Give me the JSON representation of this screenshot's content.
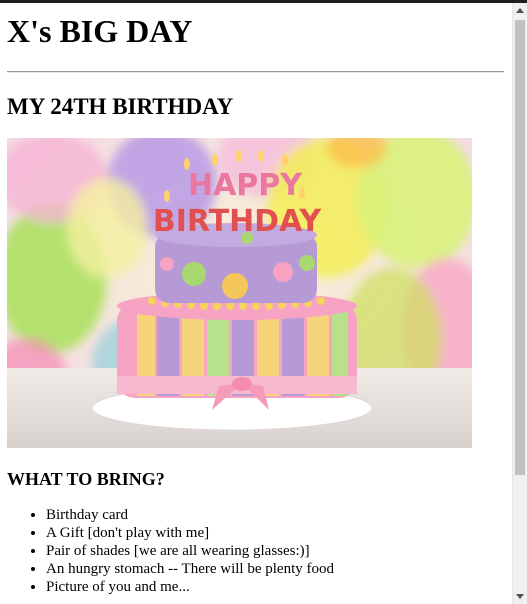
{
  "page": {
    "title": "X's BIG DAY",
    "subtitle": "MY 24TH BIRTHDAY",
    "section_heading": "WHAT TO BRING?",
    "image": {
      "cake_topper_line1": "HAPPY",
      "cake_topper_line2": "BIRTHDAY"
    },
    "bring_list": [
      "Birthday card",
      "A Gift [don't play with me]",
      "Pair of shades [we are all wearing glasses:)]",
      "An hungry stomach -- There will be plenty food",
      "Picture of you and me..."
    ]
  },
  "colors": {
    "cake_purple": "#b59ad6",
    "cake_pink": "#f6a3c4",
    "balloon_yellow": "#f2e74a",
    "balloon_green": "#a7e35a",
    "scrollbar_thumb": "#c1c1c1"
  },
  "icons": {
    "scroll_up": "triangle-up",
    "scroll_down": "triangle-down"
  }
}
